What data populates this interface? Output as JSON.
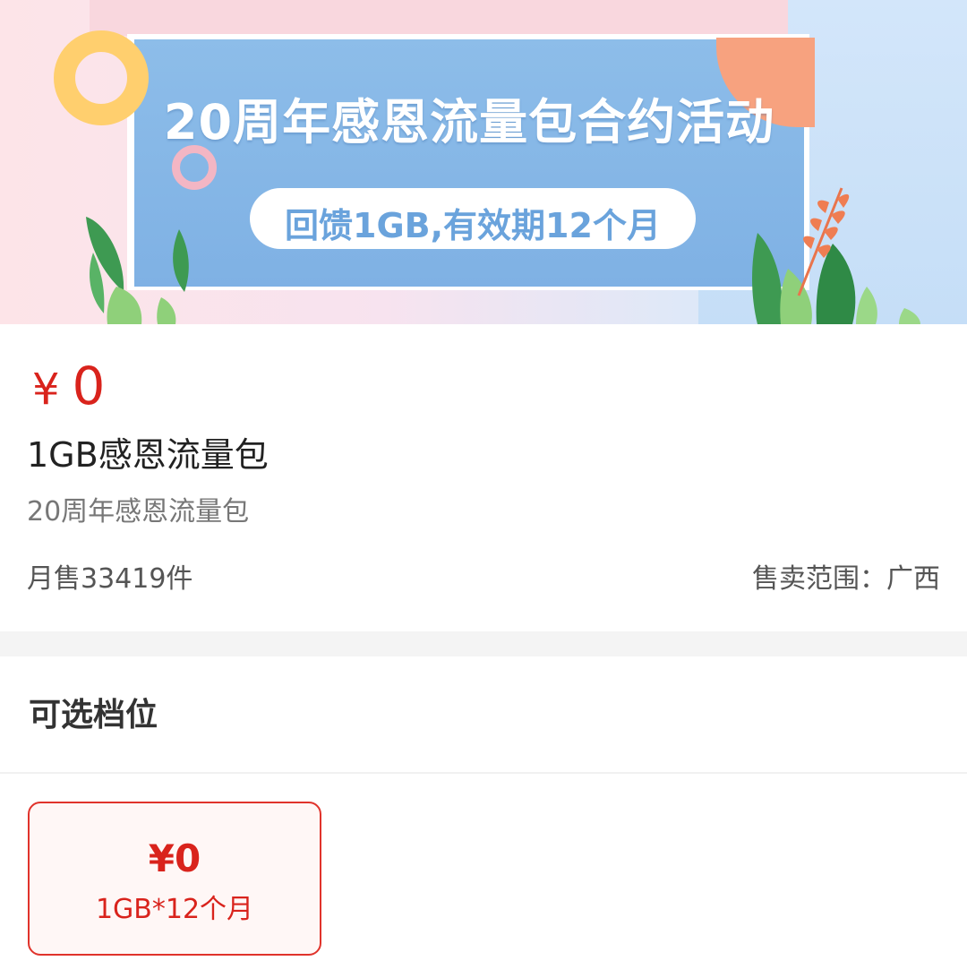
{
  "banner": {
    "headline": "20周年感恩流量包合约活动",
    "subline": "回馈1GB,有效期12个月"
  },
  "product": {
    "currency": "¥",
    "price": "0",
    "title": "1GB感恩流量包",
    "subtitle": "20周年感恩流量包",
    "monthly_sales": "月售33419件",
    "sales_region": "售卖范围：广西"
  },
  "options_section": {
    "title": "可选档位",
    "options": [
      {
        "price": "¥0",
        "spec": "1GB*12个月",
        "selected": true
      }
    ]
  },
  "colors": {
    "price_red": "#d9231c",
    "banner_blue": "#8dbde9"
  }
}
